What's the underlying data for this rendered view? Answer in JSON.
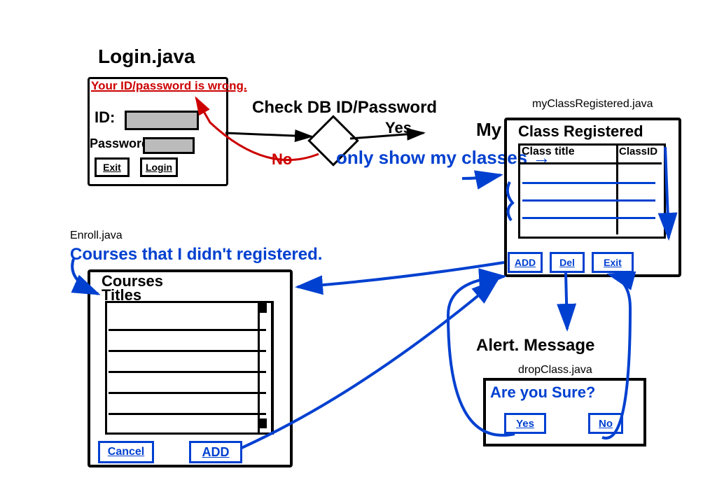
{
  "login": {
    "file": "Login.java",
    "error": "Your ID/password is wrong.",
    "id_label": "ID:",
    "pw_label": "Password:",
    "exit": "Exit",
    "login": "Login"
  },
  "decision": {
    "label": "Check DB ID/Password",
    "yes": "Yes",
    "no": "No",
    "only_show": "only show my classes →",
    "my": "My"
  },
  "registered": {
    "file": "myClassRegistered.java",
    "header": "Class Registered",
    "col1": "Class title",
    "col2": "ClassID",
    "add": "ADD",
    "del": "Del",
    "exit": "Exit"
  },
  "enroll": {
    "file": "Enroll.java",
    "note": "Courses that I didn't registered.",
    "header": "Courses\nTitles",
    "cancel": "Cancel",
    "add": "ADD"
  },
  "drop": {
    "alert": "Alert. Message",
    "file": "dropClass.java",
    "question": "Are you Sure?",
    "yes": "Yes",
    "no": "No"
  }
}
